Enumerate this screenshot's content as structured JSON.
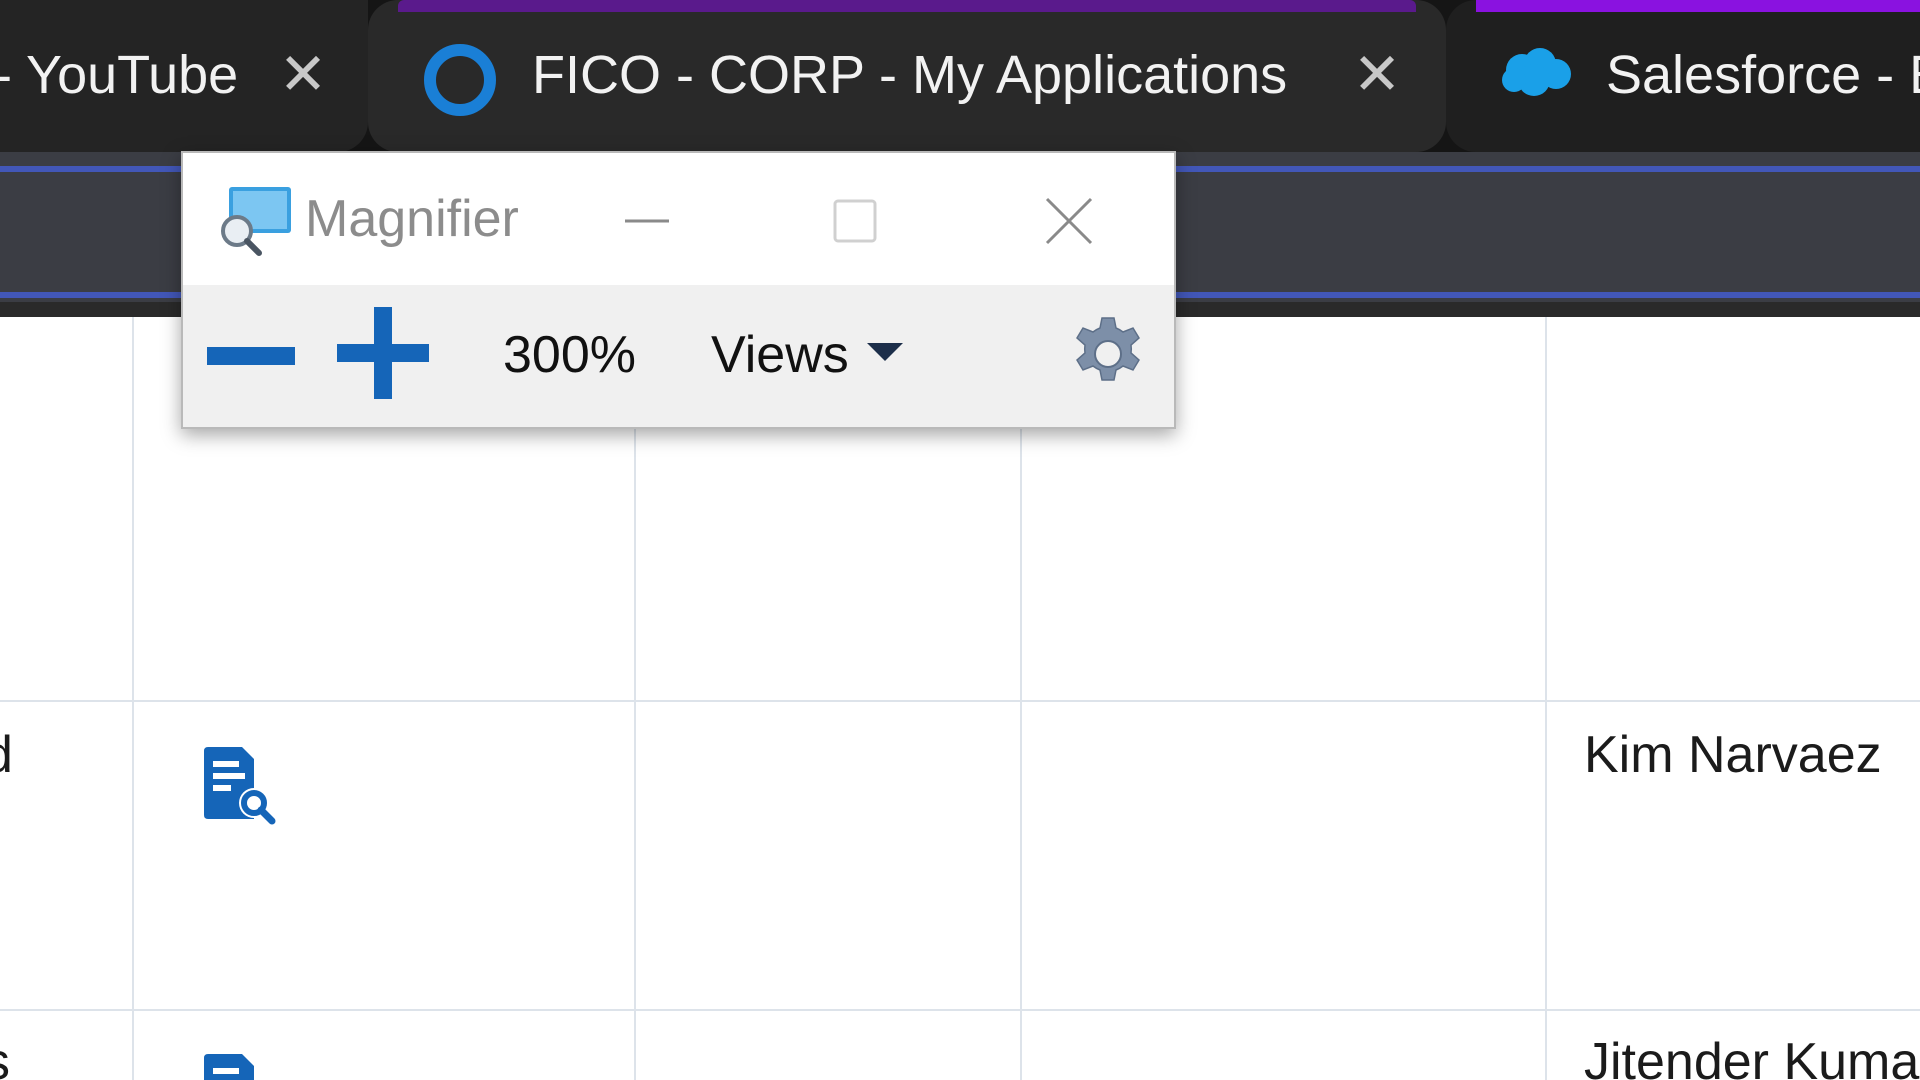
{
  "browser": {
    "tabs": [
      {
        "title": "- YouTube",
        "close": "✕"
      },
      {
        "title": "FICO - CORP - My Applications",
        "close": "✕"
      },
      {
        "title": "Salesforce - E"
      }
    ],
    "colors": {
      "active_tab_accent": "#5a1a8c",
      "salesforce_tab_accent": "#8a12e0",
      "fico_icon": "#1a7fd6",
      "salesforce_icon": "#1aa0e8"
    }
  },
  "magnifier": {
    "title": "Magnifier",
    "zoom_level": "300%",
    "views_label": "Views",
    "colors": {
      "zoom_buttons": "#1565b8",
      "gear": "#7d8fa8"
    }
  },
  "table": {
    "rows": [
      {
        "first_col_fragment": "",
        "has_doc_icon": false,
        "owner": ""
      },
      {
        "first_col_fragment": "d",
        "has_doc_icon": true,
        "owner": "Kim Narvaez"
      },
      {
        "first_col_fragment": "s",
        "has_doc_icon": true,
        "owner": "Jitender Kuma"
      }
    ],
    "colors": {
      "doc_icon": "#1565b8",
      "grid": "#dde3ea"
    }
  }
}
